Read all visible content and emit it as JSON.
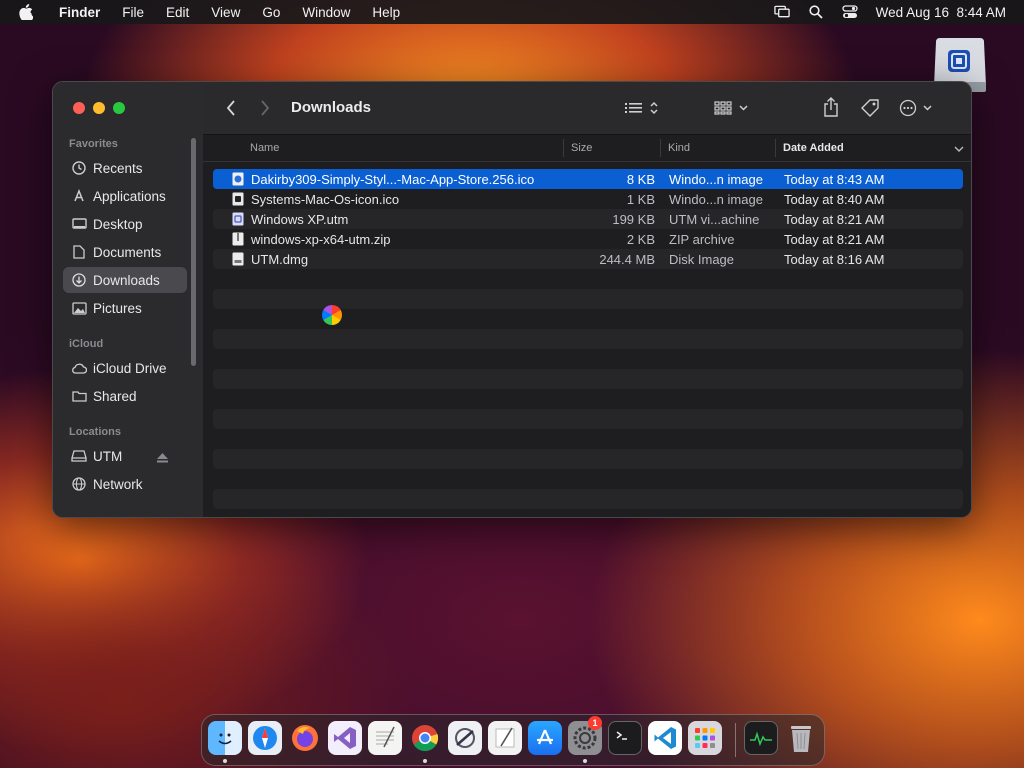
{
  "menubar": {
    "app": "Finder",
    "items": [
      "File",
      "Edit",
      "View",
      "Go",
      "Window",
      "Help"
    ],
    "clock": "Wed Aug 16  8:44 AM"
  },
  "window": {
    "title": "Downloads",
    "sidebar": {
      "favorites_title": "Favorites",
      "favorites": [
        "Recents",
        "Applications",
        "Desktop",
        "Documents",
        "Downloads",
        "Pictures"
      ],
      "icloud_title": "iCloud",
      "icloud": [
        "iCloud Drive",
        "Shared"
      ],
      "locations_title": "Locations",
      "locations": [
        "UTM",
        "Network"
      ]
    },
    "columns": {
      "name": "Name",
      "size": "Size",
      "kind": "Kind",
      "date": "Date Added"
    },
    "files": [
      {
        "name": "Dakirby309-Simply-Styl...-Mac-App-Store.256.ico",
        "size": "8 KB",
        "kind": "Windo...n image",
        "date": "Today at 8:43 AM"
      },
      {
        "name": "Systems-Mac-Os-icon.ico",
        "size": "1 KB",
        "kind": "Windo...n image",
        "date": "Today at 8:40 AM"
      },
      {
        "name": "Windows XP.utm",
        "size": "199 KB",
        "kind": "UTM vi...achine",
        "date": "Today at 8:21 AM"
      },
      {
        "name": "windows-xp-x64-utm.zip",
        "size": "2 KB",
        "kind": "ZIP archive",
        "date": "Today at 8:21 AM"
      },
      {
        "name": "UTM.dmg",
        "size": "244.4 MB",
        "kind": "Disk Image",
        "date": "Today at 8:16 AM"
      }
    ]
  },
  "dock": {
    "badge": "1",
    "icons": [
      "finder-icon",
      "safari-icon",
      "firefox-icon",
      "visual-studio-icon",
      "textedit-icon",
      "chrome-icon",
      "utm-icon",
      "script-editor-icon",
      "app-store-icon",
      "system-settings-icon",
      "terminal-icon",
      "vscode-icon",
      "launchpad-icon",
      "activity-monitor-icon",
      "trash-icon"
    ]
  },
  "colors": {
    "selection": "#0a5fd2",
    "accent_red": "#fe5f57",
    "accent_yellow": "#febc2e",
    "accent_green": "#28c840"
  }
}
